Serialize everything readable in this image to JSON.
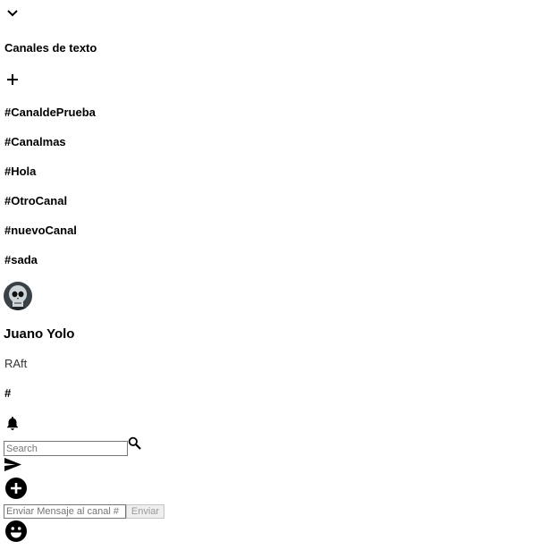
{
  "sidebar": {
    "section_title": "Canales de texto",
    "channels": [
      "#CanaldePrueba",
      "#Canalmas",
      "#Hola",
      "#OtroCanal",
      "#nuevoCanal",
      "#sada"
    ]
  },
  "user": {
    "name": "Juano Yolo",
    "status": "RAft"
  },
  "header": {
    "channel_hash": "#"
  },
  "search": {
    "placeholder": "Search"
  },
  "composer": {
    "placeholder": "Enviar Mensaje al canal #",
    "send_label": "Enviar"
  },
  "icons": {
    "collapse": "chevron-down-icon",
    "add_channel": "plus-icon",
    "notifications": "bell-icon",
    "search": "search-icon",
    "send": "send-icon",
    "attach": "add-circle-icon",
    "emoji": "emoji-icon"
  }
}
